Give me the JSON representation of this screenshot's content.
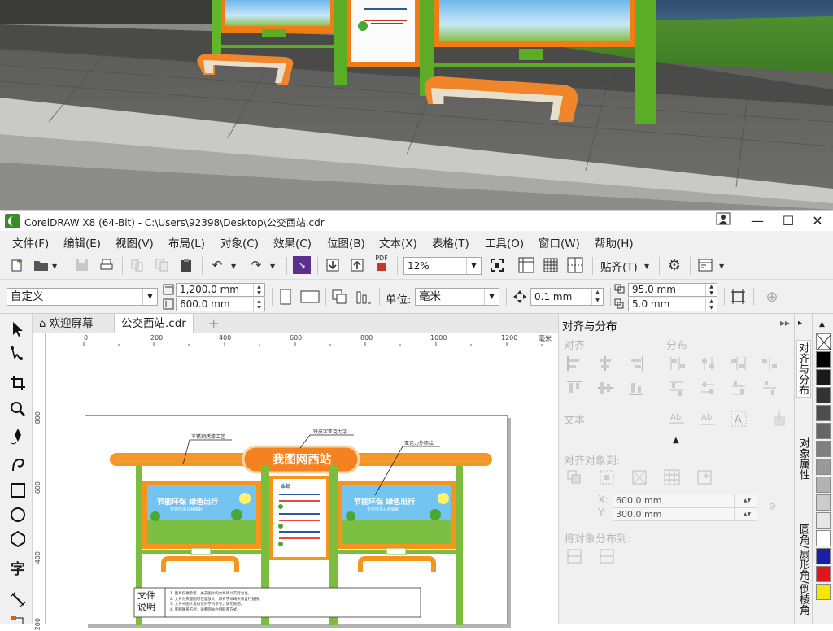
{
  "window": {
    "title": "CorelDRAW X8 (64-Bit) - C:\\Users\\92398\\Desktop\\公交西站.cdr"
  },
  "menu": [
    "文件(F)",
    "编辑(E)",
    "视图(V)",
    "布局(L)",
    "对象(C)",
    "效果(C)",
    "位图(B)",
    "文本(X)",
    "表格(T)",
    "工具(O)",
    "窗口(W)",
    "帮助(H)"
  ],
  "toolbar1": {
    "pdf_label": "PDF",
    "zoom_value": "12%",
    "snap_label": "贴齐(T)"
  },
  "toolbar2": {
    "page_preset": "自定义",
    "page_width": "1,200.0 mm",
    "page_height": "600.0 mm",
    "units_label": "单位:",
    "units_value": "毫米",
    "nudge_value": "0.1 mm",
    "dup_x": "95.0 mm",
    "dup_y": "5.0 mm"
  },
  "tabs": {
    "welcome": "欢迎屏幕",
    "document": "公交西站.cdr"
  },
  "ruler": {
    "top_ticks": [
      "0",
      "200",
      "400",
      "600",
      "800",
      "1000",
      "1200"
    ],
    "unit": "毫米",
    "left_ticks": [
      "800",
      "600",
      "400",
      "200"
    ]
  },
  "artwork": {
    "sign_title": "我图网西站",
    "left_callout": "不锈钢烤漆工艺",
    "mid_callout": "铁皮字亚克力字",
    "right_callout": "亚克力外喷绘",
    "poster_left_title": "节能环保 绿色出行",
    "poster_left_sub": "爱护环境从我做起",
    "poster_right_title": "节能环保 绿色出行",
    "poster_right_sub": "爱护环境从我做起",
    "schedule_header": "本站",
    "notes_label": "文件\n说明",
    "notes_lines": [
      "1. 图片仅供参考，关于图片的文件请以实际为准。",
      "2. 文件为矢量图可任意放大，如有字体缺失请自行替换。",
      "3. 文件中图片素材仅供学习参考，请勿商用。",
      "4. 客服联系方式：请看网站右侧联系方式。"
    ]
  },
  "docker": {
    "title": "对齐与分布",
    "sec_align": "对齐",
    "sec_distribute": "分布",
    "sec_text": "文本",
    "sec_align_to": "对齐对象到:",
    "pos_x_label": "X:",
    "pos_x_value": "600.0 mm",
    "pos_y_label": "Y:",
    "pos_y_value": "300.0 mm",
    "sec_distribute_to": "将对象分布到:"
  },
  "docker_tabs": [
    "对齐与分布",
    "对象属性",
    "圆角/扇形角/倒棱角"
  ],
  "palette": [
    "#ffffff",
    "#000000",
    "#1a1a1a",
    "#333333",
    "#4d4d4d",
    "#666666",
    "#808080",
    "#999999",
    "#b3b3b3",
    "#cccccc",
    "#e6e6e6",
    "#ffffff",
    "#1b1fa8",
    "#e0151b",
    "#f7e600"
  ]
}
